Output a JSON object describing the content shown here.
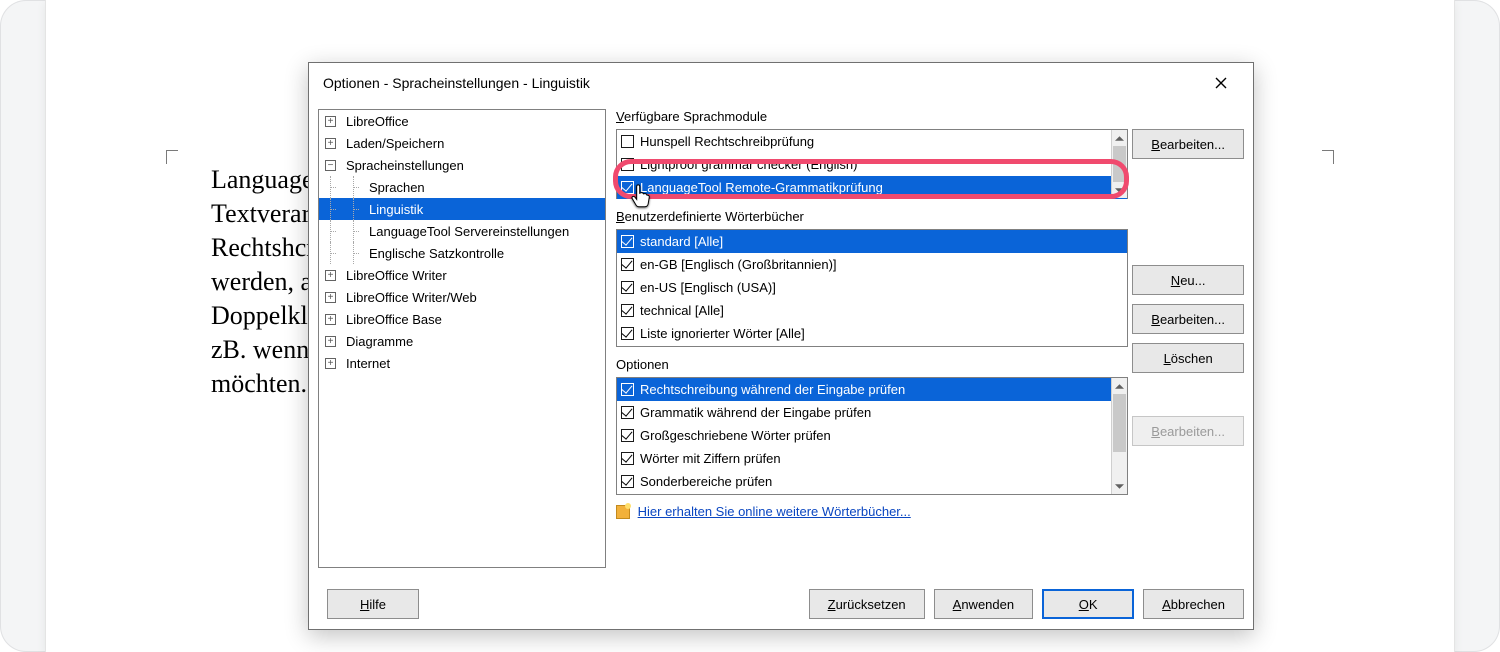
{
  "dialog_title": "Optionen - Spracheinstellungen - Linguistik",
  "background_paragraph": "LanguageTo\nTextverarbe\nRechtshcrei                                                                                                                                                                                       ler\nwerden, and\nDoppelklick                                                                                                                                                                                   agen,\nzB. wenn Si\nmöchten.",
  "tree": {
    "top": [
      {
        "label": "LibreOffice",
        "exp": "collapsed"
      },
      {
        "label": "Laden/Speichern",
        "exp": "collapsed"
      },
      {
        "label": "Spracheinstellungen",
        "exp": "expanded"
      }
    ],
    "lang_children": [
      "Sprachen",
      "Linguistik",
      "LanguageTool Servereinstellungen",
      "Englische Satzkontrolle"
    ],
    "selected_lang_child_index": 1,
    "bottom": [
      {
        "label": "LibreOffice Writer",
        "exp": "collapsed"
      },
      {
        "label": "LibreOffice Writer/Web",
        "exp": "collapsed"
      },
      {
        "label": "LibreOffice Base",
        "exp": "collapsed"
      },
      {
        "label": "Diagramme",
        "exp": "collapsed"
      },
      {
        "label": "Internet",
        "exp": "collapsed"
      }
    ]
  },
  "sections": {
    "modules_head": "erfügbare Sprachmodule",
    "modules_head_u": "V",
    "dicts_head": "enutzerdefinierte Wörterbücher",
    "dicts_head_u": "B",
    "options_head": "Optionen"
  },
  "modules": [
    {
      "label": "Hunspell Rechtschreibprüfung",
      "checked": false
    },
    {
      "label": "Lightproof grammar checker (English)",
      "checked": false
    },
    {
      "label": "LanguageTool Remote-Grammatikprüfung",
      "checked": true
    }
  ],
  "modules_selected_index": 2,
  "dicts": [
    {
      "label": "standard [Alle]",
      "checked": true
    },
    {
      "label": "en-GB [Englisch (Großbritannien)]",
      "checked": true
    },
    {
      "label": "en-US [Englisch (USA)]",
      "checked": true
    },
    {
      "label": "technical [Alle]",
      "checked": true
    },
    {
      "label": "Liste ignorierter Wörter [Alle]",
      "checked": true
    }
  ],
  "dicts_selected_index": 0,
  "options": [
    {
      "label": "Rechtschreibung während der Eingabe prüfen",
      "checked": true
    },
    {
      "label": "Grammatik während der Eingabe prüfen",
      "checked": true
    },
    {
      "label": "Großgeschriebene Wörter prüfen",
      "checked": true
    },
    {
      "label": "Wörter mit Ziffern prüfen",
      "checked": true
    },
    {
      "label": "Sonderbereiche prüfen",
      "checked": true
    }
  ],
  "options_selected_index": 0,
  "link_text": "Hier erhalten Sie online weitere Wörterbücher...",
  "buttons": {
    "edit": "earbeiten...",
    "edit_u": "B",
    "new": "eu...",
    "new_u": "N",
    "delete": "öschen",
    "delete_u": "L",
    "help": "ilfe",
    "help_u": "H",
    "reset": "urücksetzen",
    "reset_u": "Z",
    "apply": "nwenden",
    "apply_u": "A",
    "ok": "K",
    "ok_u": "O",
    "cancel": "bbrechen",
    "cancel_u": "A"
  }
}
